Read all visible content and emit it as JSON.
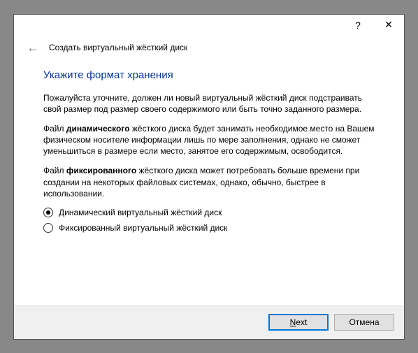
{
  "titlebar": {
    "help_icon": "?",
    "close_icon": "✕"
  },
  "header": {
    "back_icon": "←",
    "title": "Создать виртуальный жёсткий диск"
  },
  "content": {
    "heading": "Укажите формат хранения",
    "intro": "Пожалуйста уточните, должен ли новый виртуальный жёсткий диск подстраивать свой размер под размер своего содержимого или быть точно заданного размера.",
    "dynamic_prefix": "Файл ",
    "dynamic_bold": "динамического",
    "dynamic_rest": " жёсткого диска будет занимать необходимое место на Вашем физическом носителе информации лишь по мере заполнения, однако не сможет уменьшиться в размере если место, занятое его содержимым, освободится.",
    "fixed_prefix": "Файл ",
    "fixed_bold": "фиксированного",
    "fixed_rest": " жёсткого диска может потребовать больше времени при создании на некоторых файловых системах, однако, обычно, быстрее в использовании.",
    "radios": {
      "dynamic": "Динамический виртуальный жёсткий диск",
      "fixed": "Фиксированный виртуальный жёсткий диск",
      "selected": "dynamic"
    }
  },
  "footer": {
    "next_label_pre": "",
    "next_underline": "N",
    "next_label_post": "ext",
    "cancel_label": "Отмена"
  }
}
